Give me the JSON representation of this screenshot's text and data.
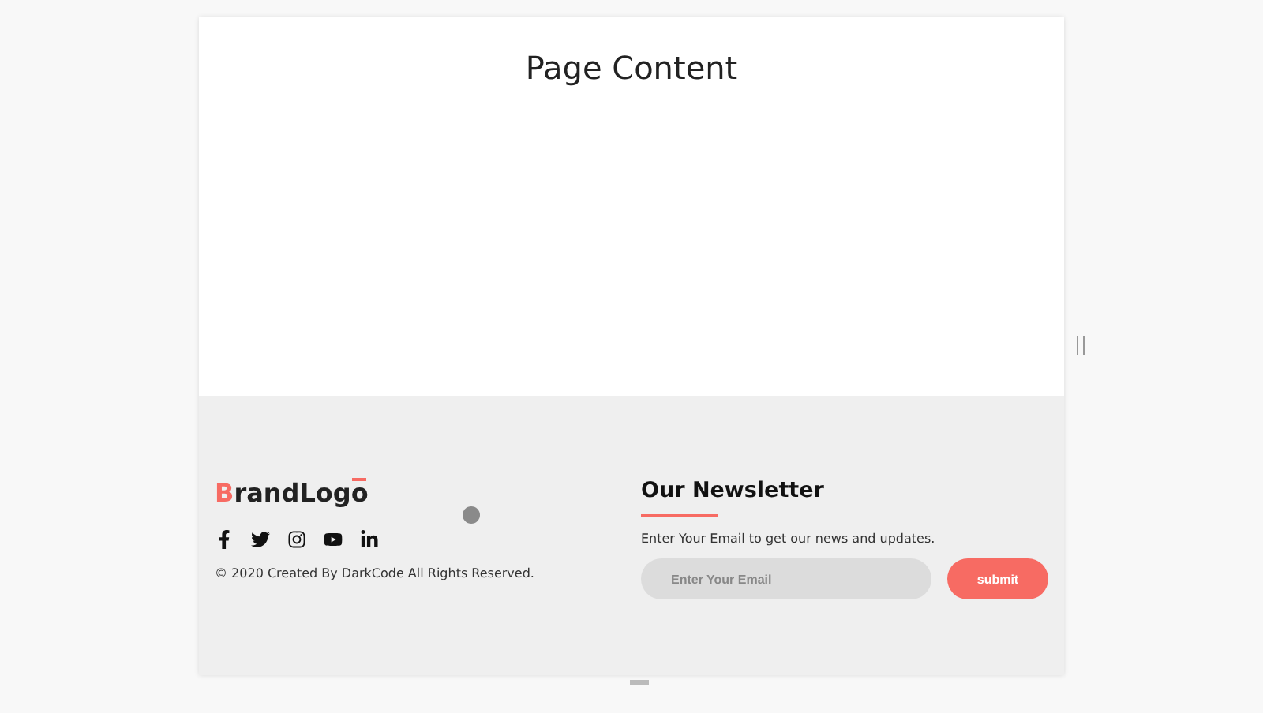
{
  "page": {
    "heading": "Page Content"
  },
  "footer": {
    "logo": "BrandLogo",
    "copyright": "© 2020 Created By DarkCode All Rights Reserved.",
    "newsletter": {
      "title": "Our Newsletter",
      "text": "Enter Your Email to get our news and updates.",
      "placeholder": "Enter Your Email",
      "button": "submit"
    }
  }
}
